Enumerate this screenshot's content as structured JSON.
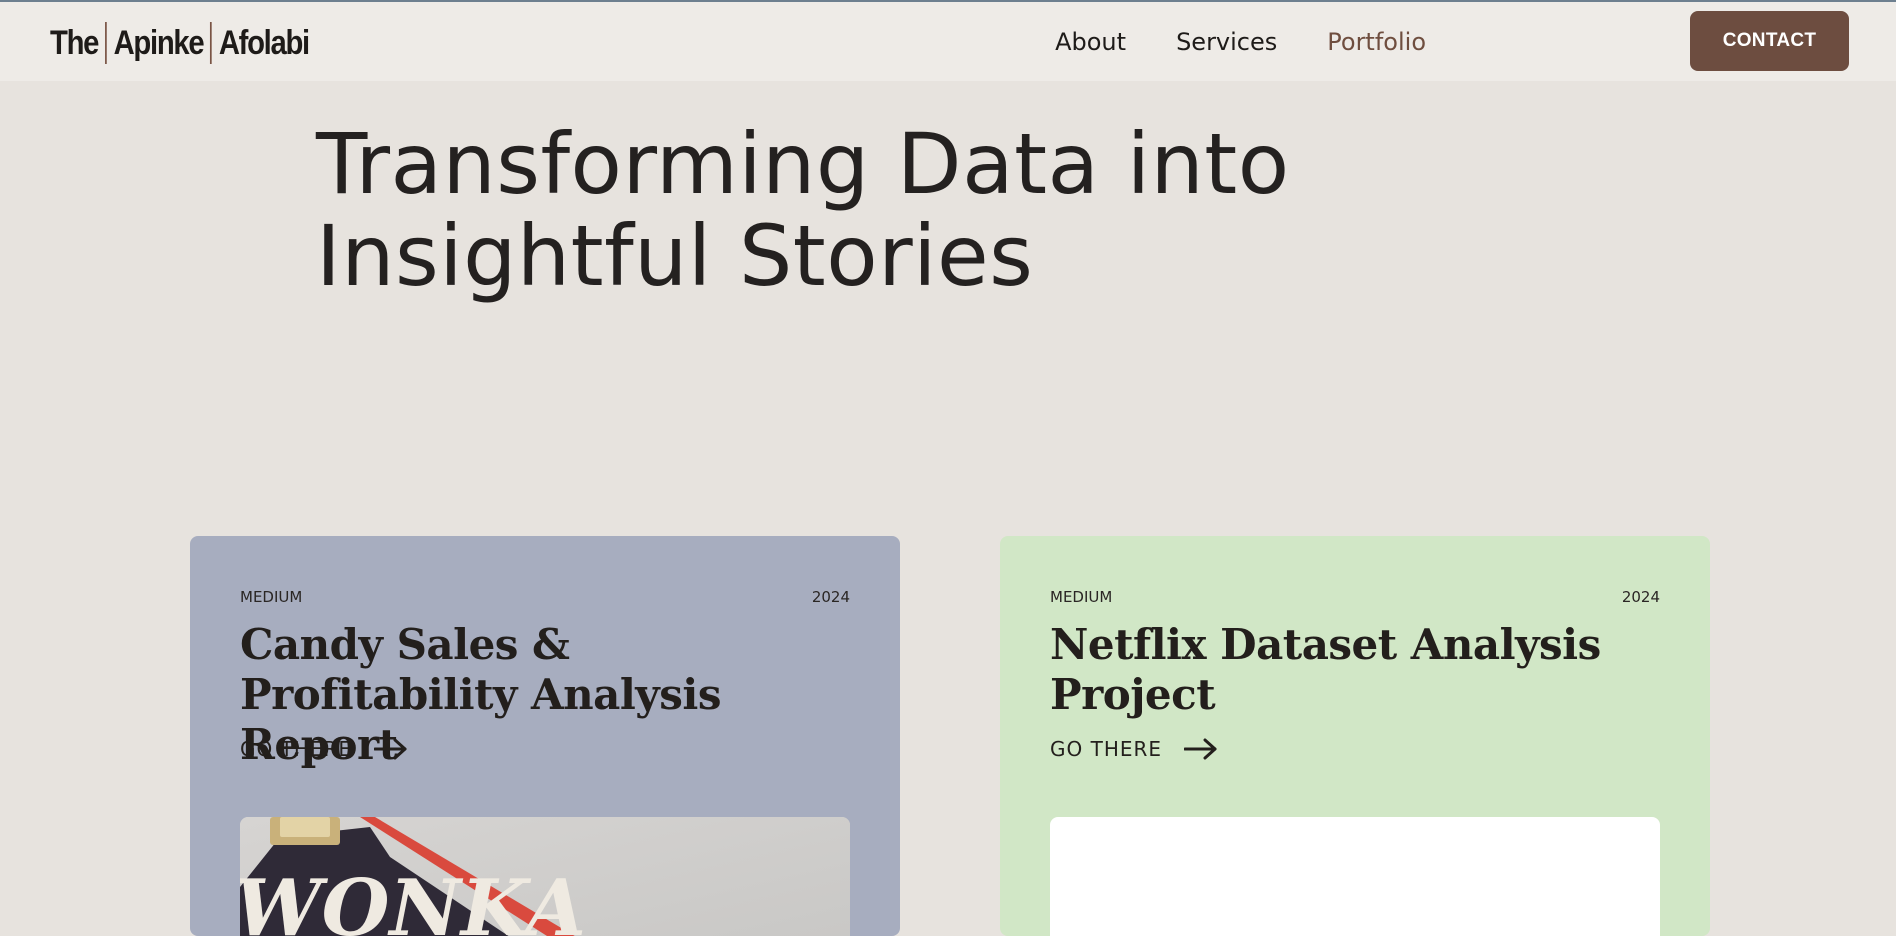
{
  "brand": {
    "part1": "The",
    "part2": "Apinke",
    "part3": "Afolabi"
  },
  "nav": {
    "items": [
      {
        "label": "About",
        "active": false
      },
      {
        "label": "Services",
        "active": false
      },
      {
        "label": "Portfolio",
        "active": true
      }
    ],
    "contact_label": "CONTACT"
  },
  "hero": {
    "line1": "Transforming Data into",
    "line2": "Insightful Stories"
  },
  "cards": [
    {
      "source": "MEDIUM",
      "year": "2024",
      "title": "Candy Sales & Profitability Analysis Report",
      "link_label": "GO THERE",
      "image_text": "WONKA",
      "background": "#a7adbf"
    },
    {
      "source": "MEDIUM",
      "year": "2024",
      "title": "Netflix Dataset Analysis Project",
      "link_label": "GO THERE",
      "background": "#d1e7c6"
    }
  ],
  "colors": {
    "accent": "#6d4d40",
    "nav_active": "#6f4e3f",
    "page_background": "#e7e3de",
    "header_background": "#eeebe7"
  },
  "icons": {
    "card_link": "arrow-right-icon"
  }
}
